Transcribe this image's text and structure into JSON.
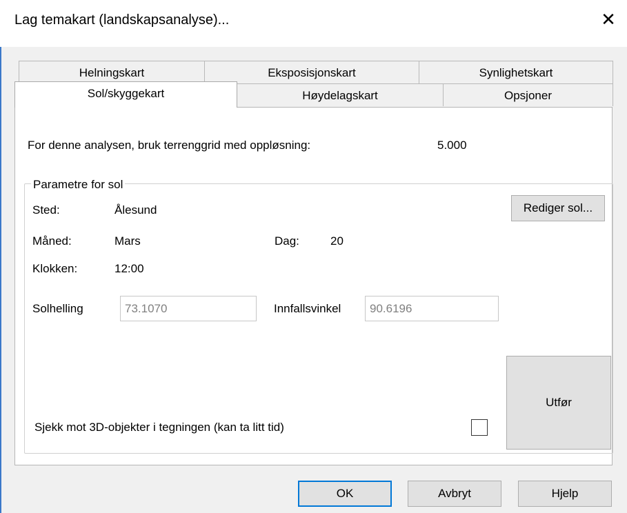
{
  "window": {
    "title": "Lag temakart (landskapsanalyse)...",
    "close_glyph": "✕"
  },
  "tabs_row1": [
    "Helningskart",
    "Eksposisjonskart",
    "Synlighetskart"
  ],
  "tabs_row2": [
    "Sol/skyggekart",
    "Høydelagskart",
    "Opsjoner"
  ],
  "analysis": {
    "label": "For denne analysen, bruk terrenggrid med oppløsning:",
    "value": "5.000"
  },
  "sun_params": {
    "group_title": "Parametre for sol",
    "place_label": "Sted:",
    "place_value": "Ålesund",
    "month_label": "Måned:",
    "month_value": "Mars",
    "day_label": "Dag:",
    "day_value": "20",
    "time_label": "Klokken:",
    "time_value": "12:00",
    "edit_button": "Rediger sol...",
    "slope_label": "Solhelling",
    "slope_value": "73.1070",
    "incidence_label": "Innfallsvinkel",
    "incidence_value": "90.6196"
  },
  "check3d": {
    "label": "Sjekk mot 3D-objekter i tegningen (kan ta litt tid)",
    "checked": false
  },
  "run_button": "Utfør",
  "footer": {
    "ok": "OK",
    "cancel": "Avbryt",
    "help": "Hjelp"
  },
  "colors": {
    "accent_border": "#3a78c9",
    "default_button_border": "#0078d7"
  }
}
